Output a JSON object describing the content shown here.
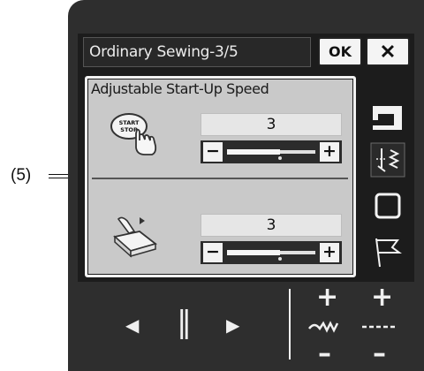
{
  "callout": {
    "label": "(5)"
  },
  "header": {
    "title": "Ordinary Sewing-3/5",
    "ok_label": "OK",
    "close_label": "✕"
  },
  "panel": {
    "title": "Adjustable Start-Up Speed",
    "rows": [
      {
        "icon": "start-stop-button-icon",
        "icon_text": "START STOP",
        "value": "3",
        "level_fraction": 0.6,
        "minus": "−",
        "plus": "+"
      },
      {
        "icon": "foot-control-icon",
        "value": "3",
        "level_fraction": 0.6,
        "minus": "−",
        "plus": "+"
      }
    ]
  },
  "side_icons": [
    "sewing-machine-icon",
    "stitch-icon",
    "square-icon",
    "flag-icon"
  ],
  "bottom": {
    "prev_label": "◀",
    "pause_label": "‖",
    "next_label": "▶",
    "plus_label": "+",
    "minus_label": "–"
  }
}
